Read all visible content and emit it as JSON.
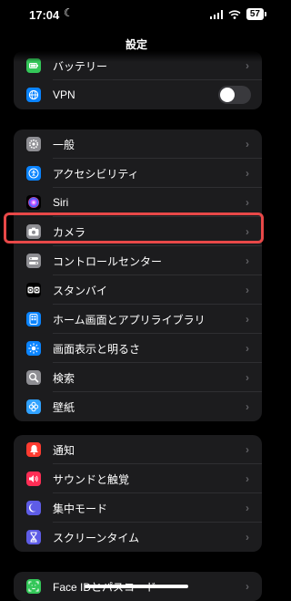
{
  "status_bar": {
    "time": "17:04",
    "battery": "57"
  },
  "nav": {
    "title": "設定"
  },
  "group1": [
    {
      "label": "バッテリー",
      "icon": "battery-icon",
      "color": "#34c759"
    },
    {
      "label": "VPN",
      "icon": "vpn-icon",
      "color": "#0a84ff",
      "toggle": false
    }
  ],
  "group2": [
    {
      "label": "一般",
      "icon": "gear-icon",
      "color": "#8e8e93"
    },
    {
      "label": "アクセシビリティ",
      "icon": "accessibility-icon",
      "color": "#0a84ff"
    },
    {
      "label": "Siri",
      "icon": "siri-icon",
      "color": "#000000"
    },
    {
      "label": "カメラ",
      "icon": "camera-icon",
      "color": "#8e8e93"
    },
    {
      "label": "コントロールセンター",
      "icon": "control-center-icon",
      "color": "#8e8e93"
    },
    {
      "label": "スタンバイ",
      "icon": "standby-icon",
      "color": "#000000"
    },
    {
      "label": "ホーム画面とアプリライブラリ",
      "icon": "home-screen-icon",
      "color": "#0a84ff"
    },
    {
      "label": "画面表示と明るさ",
      "icon": "brightness-icon",
      "color": "#0a84ff"
    },
    {
      "label": "検索",
      "icon": "search-icon",
      "color": "#8e8e93"
    },
    {
      "label": "壁紙",
      "icon": "wallpaper-icon",
      "color": "#30a2ff"
    }
  ],
  "group3": [
    {
      "label": "通知",
      "icon": "bell-icon",
      "color": "#ff3b30"
    },
    {
      "label": "サウンドと触覚",
      "icon": "speaker-icon",
      "color": "#ff2d55"
    },
    {
      "label": "集中モード",
      "icon": "moon-icon",
      "color": "#5e5ce6"
    },
    {
      "label": "スクリーンタイム",
      "icon": "hourglass-icon",
      "color": "#5e5ce6"
    }
  ],
  "group4": [
    {
      "label": "Face IDとパスコード",
      "icon": "face-id-icon",
      "color": "#34c759"
    }
  ]
}
